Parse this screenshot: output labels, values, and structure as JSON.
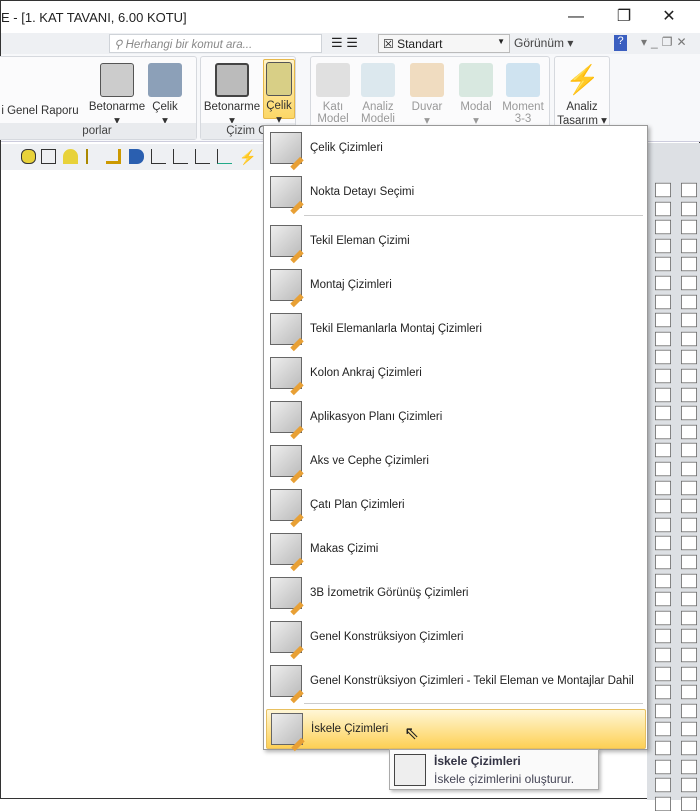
{
  "window": {
    "title": "E - [1. KAT TAVANI,  6.00 KOTU]",
    "minimize": "—",
    "restore": "❐",
    "close": "✕"
  },
  "quickbar": {
    "search_placeholder": "Herhangi bir komut ara...",
    "style_value": "Standart",
    "view_label": "Görünüm"
  },
  "ribbon": {
    "groups": [
      {
        "label": "porlar",
        "buttons": [
          {
            "label": "i Genel Raporu"
          },
          {
            "label": "Betonarme"
          },
          {
            "label": "Çelik"
          }
        ]
      },
      {
        "label": "Çizim Ol",
        "buttons": [
          {
            "label": "Betonarme"
          },
          {
            "label": "Çelik"
          }
        ]
      },
      {
        "label": "",
        "buttons": [
          {
            "label": "Katı Model"
          },
          {
            "label": "Analiz Modeli"
          },
          {
            "label": "Duvar"
          },
          {
            "label": "Modal"
          },
          {
            "label": "Moment 3-3"
          }
        ]
      },
      {
        "label": "",
        "buttons": [
          {
            "label": "Analiz Tasarım"
          }
        ]
      }
    ]
  },
  "menu": {
    "items": [
      {
        "label": "Çelik Çizimleri"
      },
      {
        "label": "Nokta Detayı Seçimi"
      },
      {
        "label": "Tekil Eleman Çizimi"
      },
      {
        "label": "Montaj Çizimleri"
      },
      {
        "label": "Tekil Elemanlarla Montaj Çizimleri"
      },
      {
        "label": "Kolon Ankraj Çizimleri"
      },
      {
        "label": "Aplikasyon Planı Çizimleri"
      },
      {
        "label": "Aks ve Cephe Çizimleri"
      },
      {
        "label": "Çatı Plan Çizimleri"
      },
      {
        "label": "Makas Çizimi"
      },
      {
        "label": "3B İzometrik Görünüş Çizimleri"
      },
      {
        "label": "Genel Konstrüksiyon Çizimleri"
      },
      {
        "label": "Genel Konstrüksiyon Çizimleri - Tekil Eleman ve Montajlar Dahil"
      },
      {
        "label": "İskele Çizimleri"
      }
    ],
    "highlighted": "İskele Çizimleri"
  },
  "tooltip": {
    "title": "İskele Çizimleri",
    "description": "İskele çizimlerini oluşturur."
  }
}
